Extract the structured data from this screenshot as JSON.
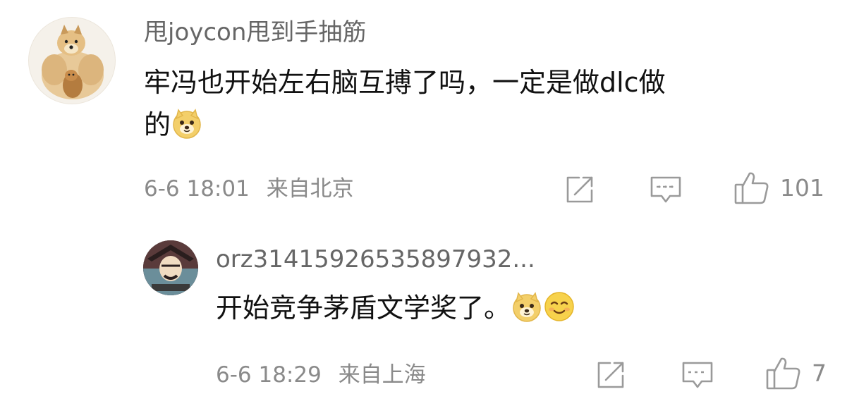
{
  "comment": {
    "username": "甩joycon甩到手抽筋",
    "text_line1": "牢冯也开始左右脑互搏了吗，一定是做dlc做",
    "text_line2": "的",
    "emoji": "doge-emoji",
    "time": "6-6 18:01",
    "location": "来自北京",
    "likes": "101"
  },
  "reply": {
    "username": "orz31415926535897932...",
    "text": "开始竞争茅盾文学奖了。",
    "emojis": [
      "doge-emoji",
      "smile-emoji"
    ],
    "time": "6-6 18:29",
    "location": "来自上海",
    "likes": "7"
  },
  "icons": {
    "share": "share-icon",
    "comment": "comment-icon",
    "like": "thumbs-up-icon"
  },
  "colors": {
    "username": "#666666",
    "meta": "#8a8a8a",
    "text": "#111111",
    "emoji_face": "#f3cf6a"
  }
}
